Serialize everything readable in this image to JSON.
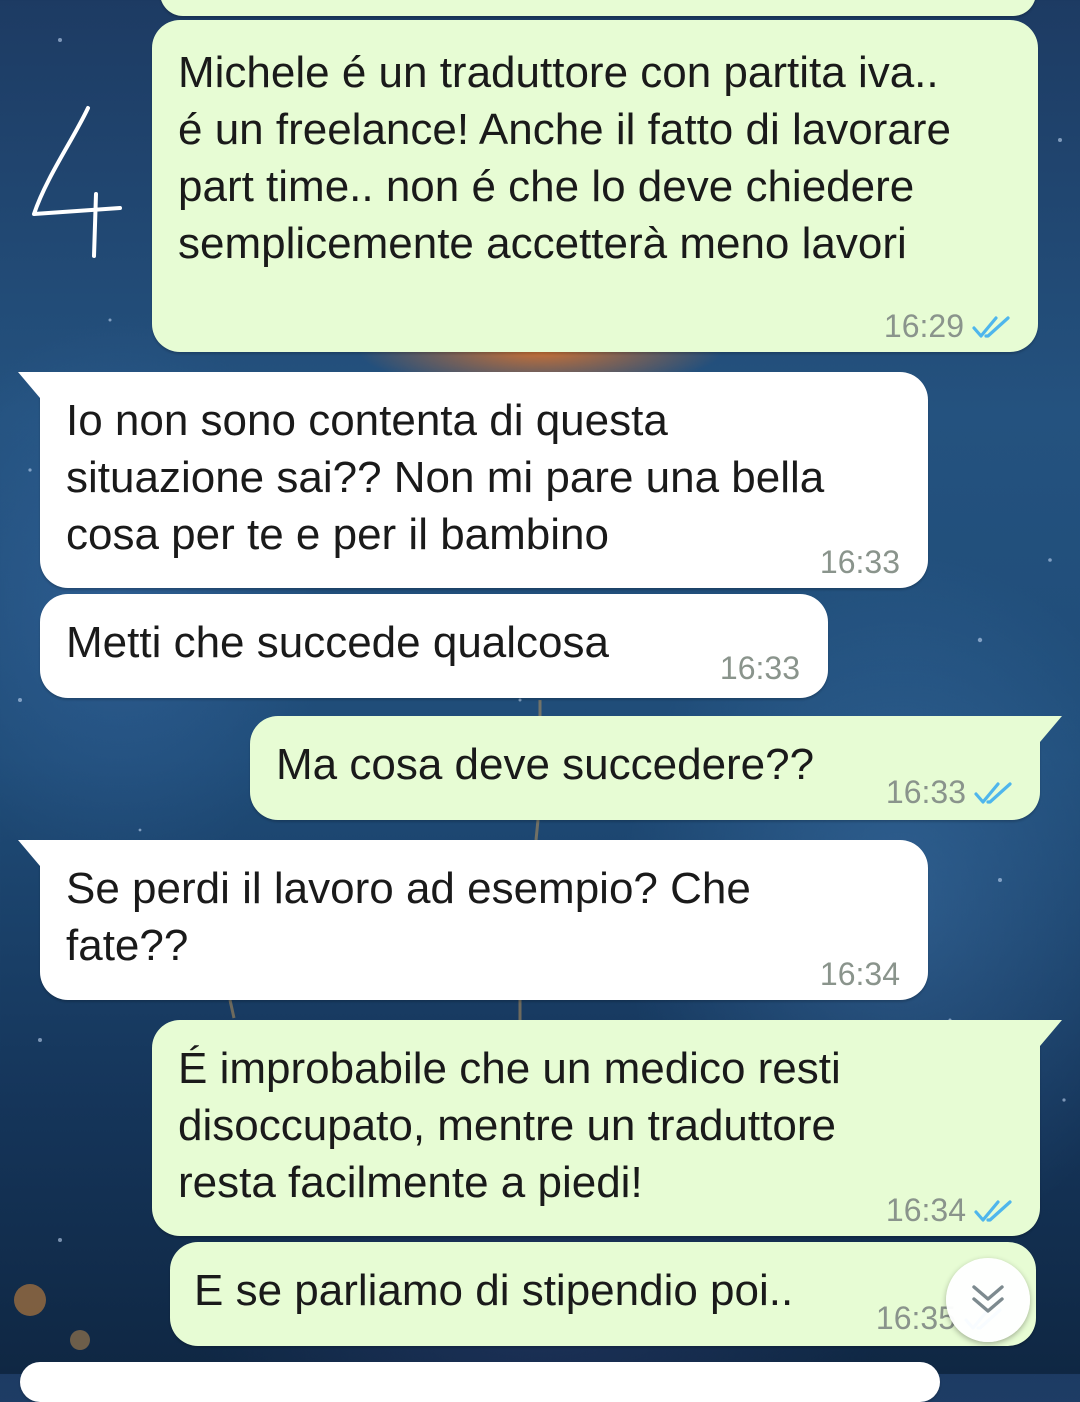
{
  "annotation": {
    "text": "4"
  },
  "messages": [
    {
      "direction": "outgoing",
      "text": "Michele é un traduttore con partita iva..\né un freelance! Anche il fatto di lavorare\npart time.. non é che lo deve chiedere\nsemplicemente accetterà meno lavori",
      "time": "16:29",
      "status": "read"
    },
    {
      "direction": "incoming",
      "text": "Io non sono contenta di questa\nsituazione sai?? Non mi pare una bella\ncosa per te e per il bambino",
      "time": "16:33"
    },
    {
      "direction": "incoming",
      "text": "Metti che succede qualcosa",
      "time": "16:33"
    },
    {
      "direction": "outgoing",
      "text": "Ma cosa deve succedere??",
      "time": "16:33",
      "status": "read"
    },
    {
      "direction": "incoming",
      "text": "Se perdi il lavoro ad esempio? Che\nfate??",
      "time": "16:34"
    },
    {
      "direction": "outgoing",
      "text": "É improbabile che un medico resti\ndisoccupato, mentre un traduttore\nresta facilmente a piedi!",
      "time": "16:34",
      "status": "read"
    },
    {
      "direction": "outgoing",
      "text": "E se parliamo di stipendio poi..",
      "time": "16:35",
      "status": "read"
    }
  ],
  "scroll_button": {
    "icon": "double-chevron-down-icon"
  },
  "colors": {
    "outgoing_bubble": "#e7fcd4",
    "incoming_bubble": "#ffffff",
    "read_ticks": "#4fb6ec",
    "timestamp": "#8a948c"
  }
}
